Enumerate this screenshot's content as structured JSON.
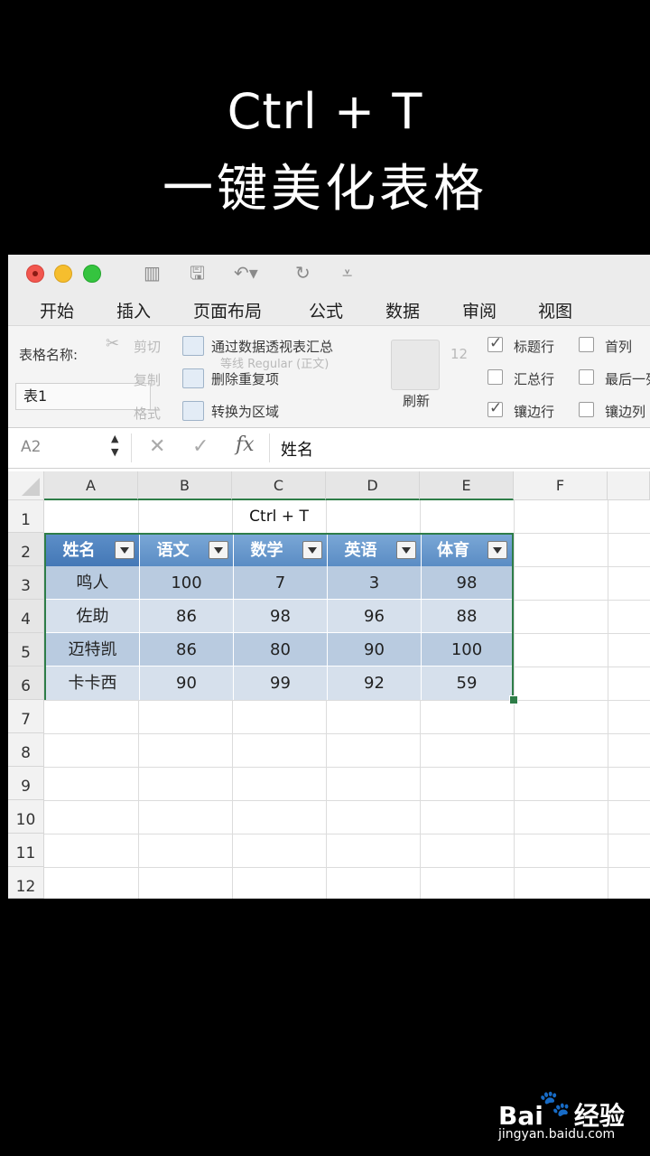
{
  "overlay": {
    "line1": "Ctrl + T",
    "line2": "一键美化表格"
  },
  "menu": [
    "开始",
    "插入",
    "页面布局",
    "公式",
    "数据",
    "审阅",
    "视图"
  ],
  "ribbon": {
    "table_name_label": "表格名称:",
    "table_name_value": "表1",
    "cut": "剪切",
    "copy": "复制",
    "format": "格式",
    "pivot_summary": "通过数据透视表汇总",
    "remove_duplicates": "删除重复项",
    "convert_to_range": "转换为区域",
    "font_ghost": "等线 Regular (正文)",
    "size_ghost": "12",
    "refresh": "刷新",
    "header_row": "标题行",
    "total_row": "汇总行",
    "banded_rows": "镶边行",
    "first_column": "首列",
    "last_column": "最后一列",
    "banded_columns": "镶边列",
    "header_row_checked": true,
    "banded_rows_checked": true
  },
  "formula_bar": {
    "cell_ref": "A2",
    "fx": "fx",
    "value": "姓名"
  },
  "columns": [
    "A",
    "B",
    "C",
    "D",
    "E",
    "F"
  ],
  "rows": [
    "1",
    "2",
    "3",
    "4",
    "5",
    "6",
    "7",
    "8",
    "9",
    "10",
    "11",
    "12"
  ],
  "sheet": {
    "title_cell": "Ctrl + T",
    "headers": [
      "姓名",
      "语文",
      "数学",
      "英语",
      "体育"
    ],
    "data": [
      [
        "鸣人",
        "100",
        "7",
        "3",
        "98"
      ],
      [
        "佐助",
        "86",
        "98",
        "96",
        "88"
      ],
      [
        "迈特凯",
        "86",
        "80",
        "90",
        "100"
      ],
      [
        "卡卡西",
        "90",
        "99",
        "92",
        "59"
      ]
    ]
  },
  "watermark": {
    "logo_left": "Bai",
    "logo_right": "经验",
    "url": "jingyan.baidu.com"
  },
  "colors": {
    "table_header": "#5a8cc4",
    "band_dark": "#b9cbe0",
    "band_light": "#d6e0ec",
    "selection": "#2e7d48"
  }
}
